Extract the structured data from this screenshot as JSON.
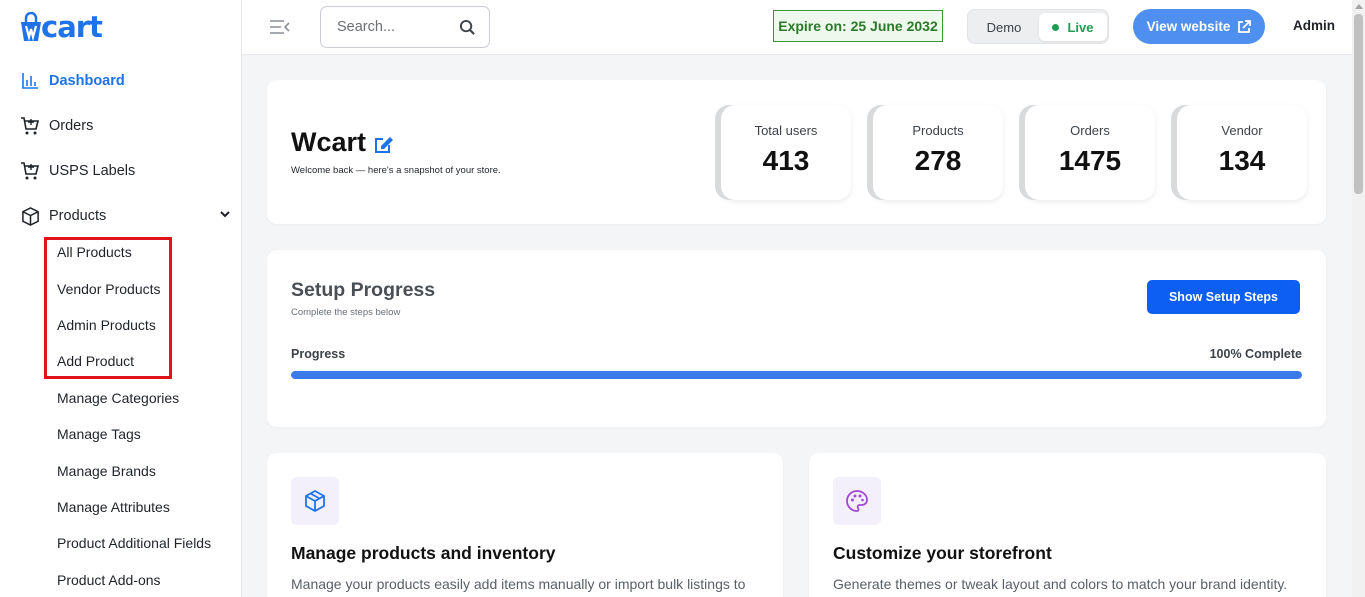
{
  "brand": {
    "name": "Wcart",
    "color": "#1f73e8"
  },
  "sidebar": {
    "items": [
      {
        "label": "Dashboard",
        "icon": "bar-chart-icon",
        "active": true
      },
      {
        "label": "Orders",
        "icon": "cart-icon"
      },
      {
        "label": "USPS Labels",
        "icon": "cart-icon"
      },
      {
        "label": "Products",
        "icon": "box-icon",
        "expanded": true
      }
    ],
    "products_sub": [
      "All Products",
      "Vendor Products",
      "Admin Products",
      "Add Product",
      "Manage Categories",
      "Manage Tags",
      "Manage Brands",
      "Manage Attributes",
      "Product Additional Fields",
      "Product Add-ons"
    ]
  },
  "header": {
    "search_placeholder": "Search...",
    "expire_text": "Expire on: 25 June 2032",
    "mode_demo": "Demo",
    "mode_live": "Live",
    "view_website": "View website",
    "user": "Admin"
  },
  "store": {
    "title": "Wcart",
    "subtitle": "Welcome back — here's a snapshot of your store.",
    "stats": [
      {
        "label": "Total users",
        "value": "413"
      },
      {
        "label": "Products",
        "value": "278"
      },
      {
        "label": "Orders",
        "value": "1475"
      },
      {
        "label": "Vendor",
        "value": "134"
      }
    ]
  },
  "setup": {
    "title": "Setup Progress",
    "subtitle": "Complete the steps below",
    "button": "Show Setup Steps",
    "progress_label": "Progress",
    "progress_text": "100% Complete",
    "progress_percent": 100
  },
  "features": [
    {
      "icon": "cube-icon",
      "title": "Manage products and inventory",
      "desc": "Manage your products easily add items manually or import bulk listings to"
    },
    {
      "icon": "palette-icon",
      "title": "Customize your storefront",
      "desc": "Generate themes or tweak layout and colors to match your brand identity."
    }
  ]
}
